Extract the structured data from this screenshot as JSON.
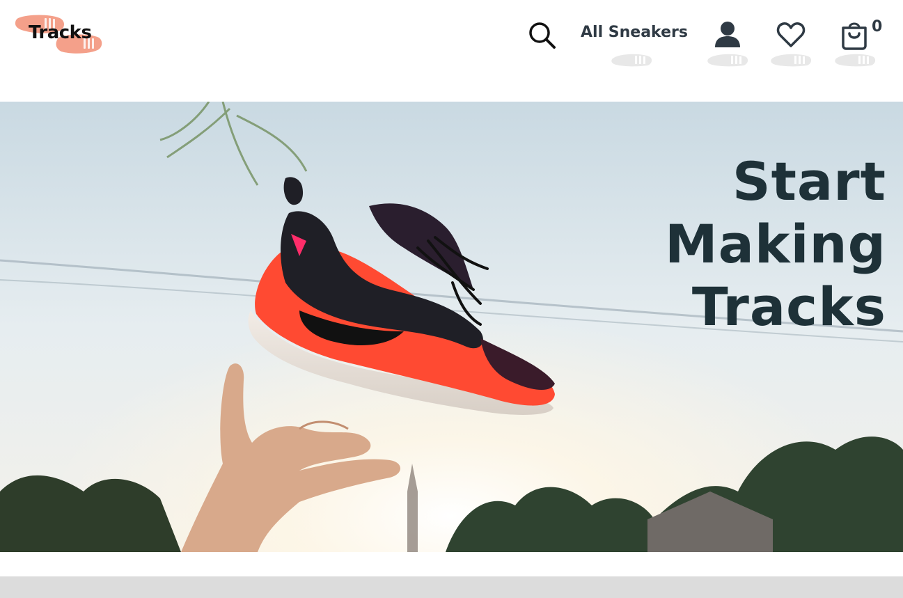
{
  "brand": {
    "name": "Tracks",
    "logo_color": "#f4a08a",
    "icon_color": "#2f3a44"
  },
  "nav": {
    "search_icon": "search-icon",
    "all_sneakers": "All Sneakers",
    "account_icon": "user-icon",
    "wishlist_icon": "heart-icon",
    "cart_icon": "shopping-bag-icon",
    "cart_count": "0"
  },
  "hero": {
    "title_lines": [
      "Start",
      "Making",
      "Tracks"
    ],
    "title_color": "#1e3138",
    "image": "photo of a red and black sneaker tossed into a sunny sky above a hand"
  }
}
